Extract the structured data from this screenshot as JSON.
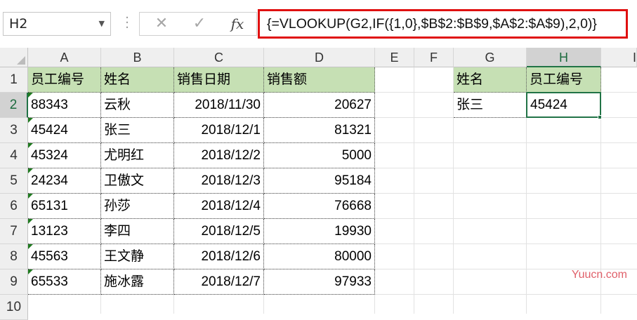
{
  "formula_bar": {
    "name_box": "H2",
    "cancel_icon": "close-icon",
    "confirm_icon": "check-icon",
    "fx_label": "fx",
    "formula": "{=VLOOKUP(G2,IF({1,0},$B$2:$B$9,$A$2:$A$9),2,0)}"
  },
  "columns": [
    "A",
    "B",
    "C",
    "D",
    "E",
    "F",
    "G",
    "H",
    "I"
  ],
  "rows": [
    "1",
    "2",
    "3",
    "4",
    "5",
    "6",
    "7",
    "8",
    "9",
    "10"
  ],
  "selected_cell": "H2",
  "table": {
    "headers": [
      "员工编号",
      "姓名",
      "销售日期",
      "销售额"
    ],
    "rows": [
      [
        "88343",
        "云秋",
        "2018/11/30",
        "20627"
      ],
      [
        "45424",
        "张三",
        "2018/12/1",
        "81321"
      ],
      [
        "45324",
        "尤明红",
        "2018/12/2",
        "5000"
      ],
      [
        "24234",
        "卫傲文",
        "2018/12/3",
        "95184"
      ],
      [
        "65131",
        "孙莎",
        "2018/12/4",
        "76668"
      ],
      [
        "13123",
        "李四",
        "2018/12/5",
        "19930"
      ],
      [
        "45563",
        "王文静",
        "2018/12/6",
        "80000"
      ],
      [
        "65533",
        "施冰露",
        "2018/12/7",
        "97933"
      ]
    ]
  },
  "lookup": {
    "headers": [
      "姓名",
      "员工编号"
    ],
    "values": [
      "张三",
      "45424"
    ]
  },
  "watermark": "Yuucn.com",
  "colors": {
    "header_fill": "#c6e0b4",
    "selection": "#217346",
    "formula_border": "#e01010",
    "text_number_triangle": "#1f7a1f"
  }
}
